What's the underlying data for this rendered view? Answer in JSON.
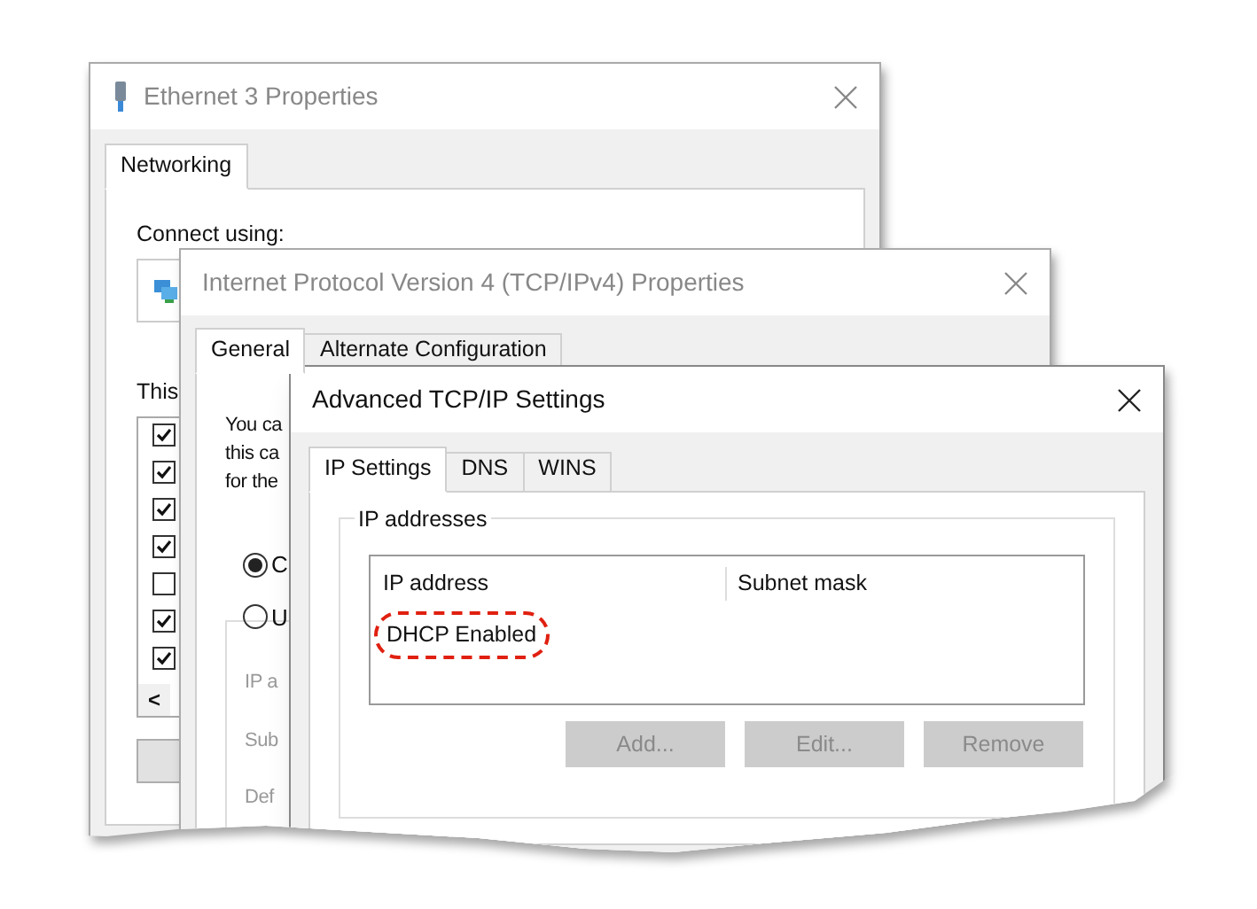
{
  "windows": [
    {
      "title": "Ethernet 3 Properties",
      "active": false,
      "tabs": [
        {
          "label": "Networking",
          "selected": true
        }
      ],
      "connect_label": "Connect using:",
      "list_label": "This",
      "components": [
        {
          "checked": true
        },
        {
          "checked": true
        },
        {
          "checked": true
        },
        {
          "checked": true
        },
        {
          "checked": false
        },
        {
          "checked": true
        },
        {
          "checked": true
        }
      ],
      "scroll_left": "<"
    },
    {
      "title": "Internet Protocol Version 4 (TCP/IPv4) Properties",
      "active": false,
      "tabs": [
        {
          "label": "General",
          "selected": true
        },
        {
          "label": "Alternate Configuration",
          "selected": false
        }
      ],
      "intro_lines": [
        "You ca",
        "this ca",
        "for the"
      ],
      "options": [
        {
          "label": "C",
          "selected": true
        },
        {
          "label": "U",
          "selected": false
        }
      ],
      "fields": [
        "IP a",
        "Sub",
        "Def"
      ]
    },
    {
      "title": "Advanced TCP/IP Settings",
      "active": true,
      "tabs": [
        {
          "label": "IP Settings",
          "selected": true
        },
        {
          "label": "DNS",
          "selected": false
        },
        {
          "label": "WINS",
          "selected": false
        }
      ],
      "group": "IP addresses",
      "columns": [
        "IP address",
        "Subnet mask"
      ],
      "rows": [
        {
          "cells": [
            "DHCP Enabled"
          ],
          "circled": true
        }
      ],
      "buttons": [
        {
          "label": "Add...",
          "disabled": true
        },
        {
          "label": "Edit...",
          "disabled": true
        },
        {
          "label": "Remove",
          "disabled": true
        }
      ]
    }
  ]
}
